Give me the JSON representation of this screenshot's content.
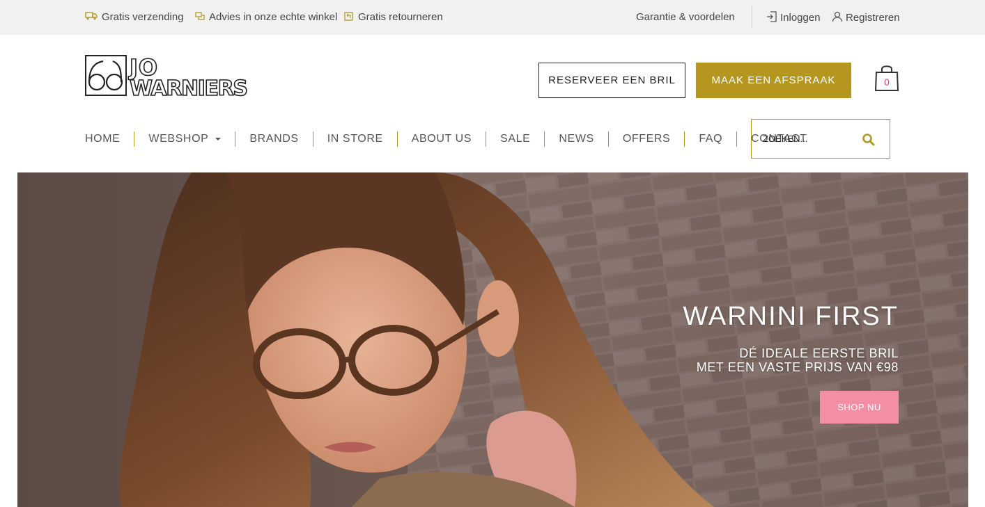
{
  "topbar": {
    "usp1": "Gratis verzending",
    "usp2": "Advies in onze echte winkel",
    "usp3": "Gratis retourneren",
    "guarantee": "Garantie & voordelen",
    "login": "Inloggen",
    "register": "Registreren",
    "icons": [
      "truck-icon",
      "chat-icon",
      "return-icon",
      "login-icon",
      "user-icon"
    ]
  },
  "logo": {
    "line1": "JO",
    "line2": "WARNIERS"
  },
  "header": {
    "reserve_label": "RESERVEER EEN BRIL",
    "appointment_label": "MAAK EEN AFSPRAAK",
    "cart_count": "0",
    "accent": "#b5961f",
    "cart_count_color": "#e0457b"
  },
  "nav": {
    "items": [
      "HOME",
      "WEBSHOP",
      "BRANDS",
      "IN STORE",
      "ABOUT US",
      "SALE",
      "NEWS",
      "OFFERS",
      "FAQ",
      "CONTACT"
    ]
  },
  "search": {
    "placeholder": "ZOEKEN..."
  },
  "hero": {
    "title": "WARNINI FIRST",
    "subtitle_line1": "DÉ IDEALE EERSTE BRIL",
    "subtitle_line2": "MET EEN VASTE PRIJS VAN €98",
    "cta": "SHOP NU",
    "cta_color": "#f28fa4"
  }
}
